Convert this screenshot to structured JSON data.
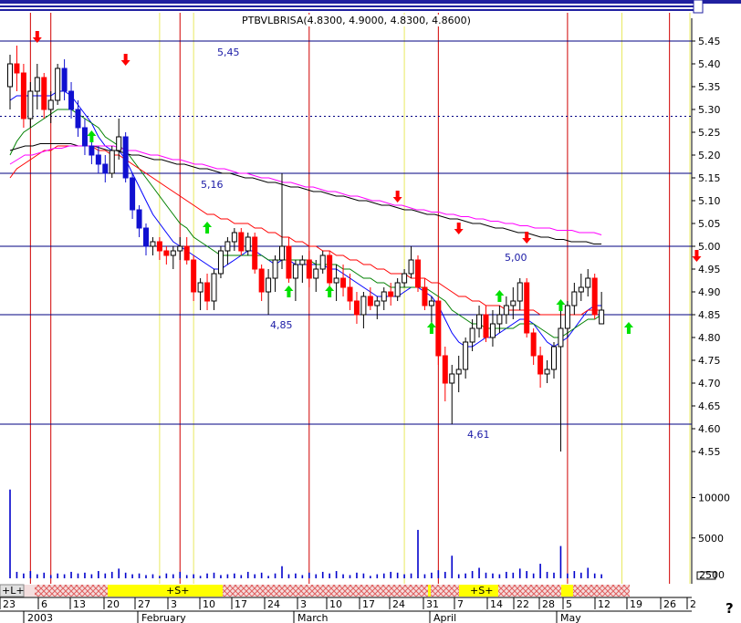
{
  "header": {
    "symbol_line": "PTBVLBRISA(4.8300, 4.9000, 4.8300, 4.8600)"
  },
  "colors": {
    "up": "#ffffff",
    "down": "#ff0000",
    "blue_body": "#1010d0",
    "ma_fast": "#0000ff",
    "ma_mid": "#008000",
    "ma_slow": "#ff0000",
    "ma_long1": "#000000",
    "ma_long2": "#ff00ff",
    "volume": "#0000cc",
    "arrow_buy": "#00e000",
    "arrow_sell": "#ff0000",
    "red_line": "#d00000",
    "yellow_line": "#e8e860"
  },
  "chart_data": {
    "type": "candlestick",
    "price_axis": {
      "ylim": [
        4.5,
        5.48
      ],
      "ticks": [
        "5.45",
        "5.40",
        "5.35",
        "5.30",
        "5.25",
        "5.20",
        "5.15",
        "5.10",
        "5.05",
        "5.00",
        "4.95",
        "4.90",
        "4.85",
        "4.80",
        "4.75",
        "4.70",
        "4.65",
        "4.60",
        "4.55"
      ]
    },
    "volume_axis": {
      "ticks": [
        "10000",
        "5000",
        "2500"
      ]
    },
    "levels": [
      {
        "value": 5.45,
        "label": "5,45",
        "style": "solid"
      },
      {
        "value": 5.285,
        "label": "",
        "style": "dashed"
      },
      {
        "value": 5.16,
        "label": "5,16",
        "style": "solid"
      },
      {
        "value": 5.0,
        "label": "5,00",
        "style": "solid"
      },
      {
        "value": 4.85,
        "label": "4,85",
        "style": "solid"
      },
      {
        "value": 4.61,
        "label": "4,61",
        "style": "solid"
      }
    ],
    "x_ticks": [
      "23",
      "6",
      "13",
      "20",
      "27",
      "3",
      "10",
      "17",
      "24",
      "3",
      "10",
      "17",
      "24",
      "31",
      "7",
      "14",
      "22",
      "28",
      "5",
      "12",
      "19",
      "26",
      "2"
    ],
    "months": [
      "2003",
      "February",
      "March",
      "April",
      "May"
    ],
    "candles": [
      [
        5.35,
        5.42,
        5.3,
        5.4
      ],
      [
        5.4,
        5.44,
        5.34,
        5.38
      ],
      [
        5.38,
        5.4,
        5.26,
        5.28
      ],
      [
        5.28,
        5.36,
        5.26,
        5.34
      ],
      [
        5.34,
        5.4,
        5.3,
        5.37
      ],
      [
        5.37,
        5.38,
        5.28,
        5.3
      ],
      [
        5.3,
        5.34,
        5.27,
        5.32
      ],
      [
        5.32,
        5.4,
        5.31,
        5.39
      ],
      [
        5.39,
        5.41,
        5.32,
        5.34
      ],
      [
        5.34,
        5.36,
        5.28,
        5.3
      ],
      [
        5.3,
        5.32,
        5.24,
        5.26
      ],
      [
        5.26,
        5.28,
        5.2,
        5.22
      ],
      [
        5.22,
        5.24,
        5.18,
        5.2
      ],
      [
        5.2,
        5.22,
        5.16,
        5.18
      ],
      [
        5.18,
        5.2,
        5.14,
        5.16
      ],
      [
        5.16,
        5.22,
        5.15,
        5.21
      ],
      [
        5.21,
        5.28,
        5.19,
        5.24
      ],
      [
        5.24,
        5.25,
        5.14,
        5.15
      ],
      [
        5.15,
        5.16,
        5.06,
        5.08
      ],
      [
        5.08,
        5.09,
        5.02,
        5.04
      ],
      [
        5.04,
        5.05,
        4.98,
        5.0
      ],
      [
        5.0,
        5.02,
        4.98,
        5.01
      ],
      [
        5.01,
        5.02,
        4.97,
        4.99
      ],
      [
        4.99,
        5.0,
        4.96,
        4.98
      ],
      [
        4.98,
        5.0,
        4.95,
        4.99
      ],
      [
        4.99,
        5.02,
        4.97,
        5.0
      ],
      [
        5.0,
        5.02,
        4.96,
        4.97
      ],
      [
        4.97,
        4.98,
        4.88,
        4.9
      ],
      [
        4.9,
        4.93,
        4.86,
        4.92
      ],
      [
        4.92,
        4.94,
        4.86,
        4.88
      ],
      [
        4.88,
        4.95,
        4.86,
        4.94
      ],
      [
        4.94,
        5.0,
        4.93,
        4.99
      ],
      [
        4.99,
        5.02,
        4.96,
        5.01
      ],
      [
        5.01,
        5.04,
        4.99,
        5.03
      ],
      [
        5.03,
        5.04,
        4.98,
        4.99
      ],
      [
        4.99,
        5.03,
        4.98,
        5.02
      ],
      [
        5.02,
        5.03,
        4.94,
        4.95
      ],
      [
        4.95,
        4.96,
        4.88,
        4.9
      ],
      [
        4.9,
        4.95,
        4.85,
        4.93
      ],
      [
        4.93,
        4.98,
        4.9,
        4.97
      ],
      [
        4.97,
        5.16,
        4.95,
        5.0
      ],
      [
        5.0,
        5.02,
        4.92,
        4.93
      ],
      [
        4.93,
        4.97,
        4.88,
        4.96
      ],
      [
        4.96,
        4.98,
        4.92,
        4.97
      ],
      [
        4.97,
        4.99,
        4.91,
        4.93
      ],
      [
        4.93,
        4.97,
        4.9,
        4.95
      ],
      [
        4.95,
        4.99,
        4.94,
        4.98
      ],
      [
        4.98,
        4.99,
        4.9,
        4.92
      ],
      [
        4.92,
        4.96,
        4.88,
        4.93
      ],
      [
        4.93,
        4.96,
        4.89,
        4.91
      ],
      [
        4.91,
        4.94,
        4.86,
        4.88
      ],
      [
        4.88,
        4.9,
        4.83,
        4.85
      ],
      [
        4.85,
        4.9,
        4.82,
        4.89
      ],
      [
        4.89,
        4.91,
        4.86,
        4.87
      ],
      [
        4.87,
        4.89,
        4.84,
        4.88
      ],
      [
        4.88,
        4.91,
        4.86,
        4.9
      ],
      [
        4.9,
        4.92,
        4.87,
        4.89
      ],
      [
        4.89,
        4.93,
        4.88,
        4.92
      ],
      [
        4.92,
        4.95,
        4.91,
        4.94
      ],
      [
        4.94,
        5.0,
        4.93,
        4.97
      ],
      [
        4.97,
        4.98,
        4.9,
        4.91
      ],
      [
        4.91,
        4.93,
        4.86,
        4.87
      ],
      [
        4.87,
        4.89,
        4.82,
        4.88
      ],
      [
        4.88,
        4.89,
        4.74,
        4.76
      ],
      [
        4.76,
        4.78,
        4.66,
        4.7
      ],
      [
        4.7,
        4.74,
        4.61,
        4.72
      ],
      [
        4.72,
        4.76,
        4.68,
        4.73
      ],
      [
        4.73,
        4.8,
        4.71,
        4.79
      ],
      [
        4.79,
        4.84,
        4.77,
        4.82
      ],
      [
        4.82,
        4.87,
        4.8,
        4.85
      ],
      [
        4.85,
        4.87,
        4.79,
        4.8
      ],
      [
        4.8,
        4.86,
        4.78,
        4.83
      ],
      [
        4.83,
        4.87,
        4.81,
        4.85
      ],
      [
        4.85,
        4.89,
        4.83,
        4.87
      ],
      [
        4.87,
        4.91,
        4.84,
        4.88
      ],
      [
        4.88,
        4.93,
        4.86,
        4.92
      ],
      [
        4.92,
        4.93,
        4.8,
        4.81
      ],
      [
        4.81,
        4.82,
        4.74,
        4.76
      ],
      [
        4.76,
        4.78,
        4.69,
        4.72
      ],
      [
        4.72,
        4.75,
        4.7,
        4.73
      ],
      [
        4.73,
        4.79,
        4.71,
        4.78
      ],
      [
        4.78,
        4.86,
        4.55,
        4.82
      ],
      [
        4.82,
        4.88,
        4.8,
        4.87
      ],
      [
        4.87,
        4.92,
        4.85,
        4.9
      ],
      [
        4.9,
        4.94,
        4.88,
        4.91
      ],
      [
        4.91,
        4.95,
        4.89,
        4.93
      ],
      [
        4.93,
        4.94,
        4.84,
        4.85
      ],
      [
        4.83,
        4.9,
        4.83,
        4.86
      ]
    ],
    "series": [
      {
        "values": [
          5.32,
          5.33,
          5.33,
          5.33,
          5.33,
          5.33,
          5.33,
          5.34,
          5.34,
          5.33,
          5.31,
          5.29,
          5.27,
          5.24,
          5.22,
          5.21,
          5.21,
          5.19,
          5.16,
          5.13,
          5.1,
          5.07,
          5.05,
          5.03,
          5.01,
          5.0,
          4.99,
          4.98,
          4.97,
          4.96,
          4.95,
          4.95,
          4.96,
          4.97,
          4.98,
          4.99,
          4.99,
          4.98,
          4.97,
          4.96,
          4.97,
          4.97,
          4.96,
          4.96,
          4.96,
          4.96,
          4.96,
          4.95,
          4.95,
          4.94,
          4.93,
          4.92,
          4.91,
          4.9,
          4.89,
          4.89,
          4.89,
          4.89,
          4.9,
          4.91,
          4.91,
          4.9,
          4.89,
          4.87,
          4.84,
          4.81,
          4.79,
          4.78,
          4.78,
          4.79,
          4.8,
          4.8,
          4.81,
          4.82,
          4.83,
          4.84,
          4.84,
          4.83,
          4.81,
          4.79,
          4.78,
          4.79,
          4.8,
          4.82,
          4.84,
          4.86,
          4.87,
          4.87
        ]
      },
      {
        "values": [
          5.2,
          5.23,
          5.25,
          5.26,
          5.27,
          5.28,
          5.29,
          5.3,
          5.3,
          5.3,
          5.29,
          5.28,
          5.27,
          5.26,
          5.24,
          5.23,
          5.22,
          5.21,
          5.19,
          5.17,
          5.15,
          5.13,
          5.11,
          5.09,
          5.07,
          5.05,
          5.04,
          5.02,
          5.01,
          5.0,
          4.99,
          4.98,
          4.98,
          4.98,
          4.98,
          4.98,
          4.98,
          4.98,
          4.97,
          4.97,
          4.97,
          4.97,
          4.97,
          4.97,
          4.97,
          4.96,
          4.96,
          4.96,
          4.96,
          4.95,
          4.95,
          4.94,
          4.93,
          4.93,
          4.92,
          4.92,
          4.91,
          4.91,
          4.91,
          4.91,
          4.91,
          4.91,
          4.9,
          4.89,
          4.88,
          4.86,
          4.85,
          4.84,
          4.83,
          4.83,
          4.82,
          4.82,
          4.82,
          4.82,
          4.82,
          4.83,
          4.83,
          4.83,
          4.82,
          4.81,
          4.8,
          4.8,
          4.81,
          4.82,
          4.83,
          4.84,
          4.84,
          4.85
        ]
      },
      {
        "values": [
          5.15,
          5.17,
          5.18,
          5.19,
          5.2,
          5.21,
          5.21,
          5.22,
          5.22,
          5.22,
          5.22,
          5.22,
          5.22,
          5.21,
          5.21,
          5.2,
          5.2,
          5.19,
          5.18,
          5.17,
          5.16,
          5.15,
          5.14,
          5.13,
          5.12,
          5.11,
          5.1,
          5.09,
          5.08,
          5.07,
          5.07,
          5.06,
          5.06,
          5.05,
          5.05,
          5.05,
          5.04,
          5.04,
          5.03,
          5.03,
          5.02,
          5.02,
          5.01,
          5.01,
          5.0,
          5.0,
          4.99,
          4.99,
          4.98,
          4.98,
          4.97,
          4.97,
          4.96,
          4.96,
          4.95,
          4.95,
          4.94,
          4.94,
          4.94,
          4.93,
          4.93,
          4.93,
          4.92,
          4.92,
          4.91,
          4.9,
          4.89,
          4.89,
          4.88,
          4.88,
          4.87,
          4.87,
          4.87,
          4.86,
          4.86,
          4.86,
          4.86,
          4.86,
          4.85,
          4.85,
          4.85,
          4.85,
          4.85,
          4.85,
          4.85,
          4.86,
          4.86,
          4.86
        ]
      },
      {
        "values": [
          5.21,
          5.215,
          5.22,
          5.22,
          5.225,
          5.225,
          5.225,
          5.225,
          5.225,
          5.22,
          5.22,
          5.22,
          5.215,
          5.21,
          5.21,
          5.205,
          5.2,
          5.2,
          5.195,
          5.19,
          5.19,
          5.185,
          5.18,
          5.18,
          5.175,
          5.17,
          5.17,
          5.165,
          5.16,
          5.16,
          5.155,
          5.15,
          5.15,
          5.145,
          5.14,
          5.14,
          5.135,
          5.13,
          5.13,
          5.125,
          5.12,
          5.12,
          5.115,
          5.11,
          5.11,
          5.105,
          5.1,
          5.1,
          5.095,
          5.09,
          5.09,
          5.085,
          5.08,
          5.08,
          5.075,
          5.07,
          5.07,
          5.065,
          5.06,
          5.06,
          5.055,
          5.05,
          5.05,
          5.045,
          5.04,
          5.04,
          5.035,
          5.03,
          5.03,
          5.025,
          5.02,
          5.02,
          5.015,
          5.015,
          5.01,
          5.01,
          5.01,
          5.005,
          5.005
        ]
      },
      {
        "values": [
          5.18,
          5.19,
          5.2,
          5.2,
          5.205,
          5.21,
          5.215,
          5.215,
          5.22,
          5.22,
          5.22,
          5.22,
          5.22,
          5.22,
          5.22,
          5.215,
          5.21,
          5.21,
          5.205,
          5.2,
          5.2,
          5.195,
          5.19,
          5.19,
          5.185,
          5.18,
          5.18,
          5.175,
          5.17,
          5.17,
          5.165,
          5.16,
          5.16,
          5.155,
          5.15,
          5.15,
          5.145,
          5.14,
          5.14,
          5.135,
          5.13,
          5.13,
          5.125,
          5.12,
          5.12,
          5.115,
          5.11,
          5.11,
          5.105,
          5.1,
          5.1,
          5.095,
          5.09,
          5.09,
          5.085,
          5.08,
          5.08,
          5.075,
          5.075,
          5.07,
          5.07,
          5.065,
          5.065,
          5.06,
          5.06,
          5.055,
          5.055,
          5.05,
          5.05,
          5.045,
          5.045,
          5.04,
          5.04,
          5.04,
          5.035,
          5.035,
          5.035,
          5.03,
          5.03,
          5.03,
          5.025
        ]
      }
    ],
    "volume": [
      11000,
      800,
      600,
      900,
      500,
      700,
      400,
      600,
      500,
      800,
      600,
      700,
      500,
      900,
      600,
      800,
      1200,
      700,
      500,
      600,
      400,
      500,
      300,
      600,
      500,
      800,
      400,
      500,
      300,
      600,
      700,
      400,
      500,
      600,
      400,
      800,
      500,
      700,
      300,
      600,
      1500,
      500,
      600,
      400,
      700,
      500,
      800,
      600,
      900,
      500,
      400,
      700,
      600,
      300,
      500,
      600,
      800,
      700,
      500,
      600,
      6000,
      500,
      700,
      1000,
      800,
      2800,
      500,
      600,
      900,
      1300,
      700,
      600,
      500,
      800,
      700,
      1200,
      900,
      600,
      1800,
      800,
      700,
      4000,
      600,
      900,
      700,
      1300,
      600,
      500
    ],
    "red_lines_at": [
      3,
      6,
      25,
      44,
      63,
      82,
      97,
      108,
      116,
      128,
      133
    ],
    "yellow_lines_at": [
      22,
      27,
      58,
      90,
      100,
      124,
      132
    ],
    "buy_arrows": [
      [
        12,
        5.26
      ],
      [
        29,
        5.06
      ],
      [
        41,
        4.92
      ],
      [
        47,
        4.92
      ],
      [
        62,
        4.84
      ],
      [
        72,
        4.91
      ],
      [
        81,
        4.89
      ],
      [
        91,
        4.84
      ],
      [
        112,
        4.71
      ],
      [
        133,
        4.74
      ]
    ],
    "sell_arrows": [
      [
        4,
        5.44
      ],
      [
        17,
        5.39
      ],
      [
        57,
        5.09
      ],
      [
        66,
        5.02
      ],
      [
        76,
        5.0
      ],
      [
        101,
        4.96
      ],
      [
        126,
        4.84
      ]
    ]
  }
}
